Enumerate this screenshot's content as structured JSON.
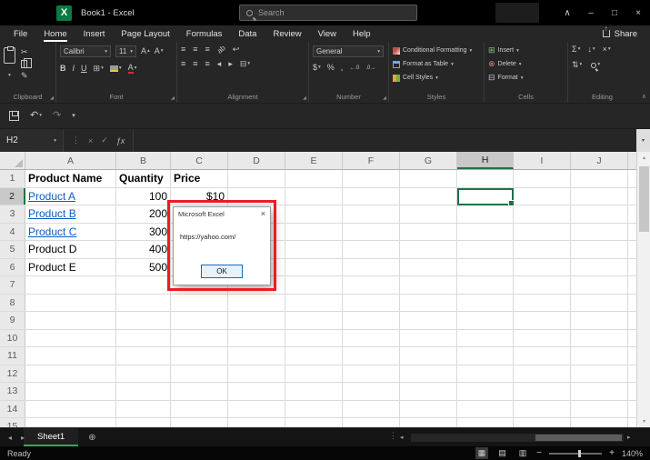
{
  "titlebar": {
    "logo_letter": "X",
    "title": "Book1 - Excel",
    "search_placeholder": "Search"
  },
  "menubar": {
    "tabs": [
      "File",
      "Home",
      "Insert",
      "Page Layout",
      "Formulas",
      "Data",
      "Review",
      "View",
      "Help"
    ],
    "active_tab": "Home",
    "share": "Share"
  },
  "ribbon": {
    "clipboard": {
      "label": "Clipboard"
    },
    "font": {
      "label": "Font",
      "font_name": "Calibri",
      "font_size": "11",
      "bold": "B",
      "italic": "I",
      "underline": "U"
    },
    "alignment": {
      "label": "Alignment",
      "orientation": "ab"
    },
    "number": {
      "label": "Number",
      "format": "General",
      "currency": "$",
      "percent": "%",
      "comma": ",",
      "inc_decimal": "←.0",
      "dec_decimal": ".0→"
    },
    "styles": {
      "label": "Styles",
      "items": [
        "Conditional Formatting",
        "Format as Table",
        "Cell Styles"
      ]
    },
    "cells": {
      "label": "Cells",
      "items": [
        "Insert",
        "Delete",
        "Format"
      ]
    },
    "editing": {
      "label": "Editing"
    }
  },
  "formula_bar": {
    "name_box": "H2",
    "fx": "ƒx"
  },
  "grid": {
    "columns": [
      "A",
      "B",
      "C",
      "D",
      "E",
      "F",
      "G",
      "H",
      "I",
      "J"
    ],
    "row_count": 15,
    "selected_cell": "H2",
    "cells": [
      {
        "ref": "A1",
        "text": "Product Name",
        "bold": true
      },
      {
        "ref": "B1",
        "text": "Quantity",
        "bold": true
      },
      {
        "ref": "C1",
        "text": "Price",
        "bold": true
      },
      {
        "ref": "A2",
        "text": "Product A",
        "link": true
      },
      {
        "ref": "B2",
        "text": "100",
        "align": "right"
      },
      {
        "ref": "C2",
        "text": "$10",
        "align": "right"
      },
      {
        "ref": "A3",
        "text": "Product B",
        "link": true
      },
      {
        "ref": "B3",
        "text": "200",
        "align": "right"
      },
      {
        "ref": "A4",
        "text": "Product C",
        "link": true
      },
      {
        "ref": "B4",
        "text": "300",
        "align": "right"
      },
      {
        "ref": "A5",
        "text": "Product D"
      },
      {
        "ref": "B5",
        "text": "400",
        "align": "right"
      },
      {
        "ref": "A6",
        "text": "Product E"
      },
      {
        "ref": "B6",
        "text": "500",
        "align": "right"
      }
    ]
  },
  "dialog": {
    "title": "Microsoft Excel",
    "message": "https://yahoo.com/",
    "ok": "OK"
  },
  "sheet_bar": {
    "tabs": [
      "Sheet1"
    ],
    "active_tab": "Sheet1"
  },
  "status_bar": {
    "mode": "Ready",
    "zoom": "140%"
  },
  "colors": {
    "accent_green": "#1f7246",
    "link_blue": "#0b5cc4",
    "annotation_red": "#ec1c24"
  },
  "icons": {
    "dropdown": "▾",
    "cut": "✂",
    "format_painter": "✎",
    "sum": "Σ",
    "fill_down": "↓",
    "clear": "×",
    "sort_filter": "⇅",
    "align": "≡",
    "wrap": "↩",
    "merge": "⊟",
    "borders": "⊞",
    "grow_shrink_letter": "A",
    "up": "▴",
    "down": "▾",
    "left": "◂",
    "right": "▸",
    "insert": "⊞",
    "delete": "⊗",
    "format": "⊟",
    "undo": "↶",
    "redo": "↷",
    "dots": "⋮",
    "check": "✓",
    "cancel": "×",
    "minimize": "–",
    "restore": "□",
    "close": "×",
    "ribbon_options": "∧",
    "add_sheet": "⊕",
    "splitter": "⋮",
    "view_normal": "▦",
    "view_layout": "▤",
    "view_break": "▥",
    "zoom_out": "−",
    "zoom_in": "+"
  }
}
